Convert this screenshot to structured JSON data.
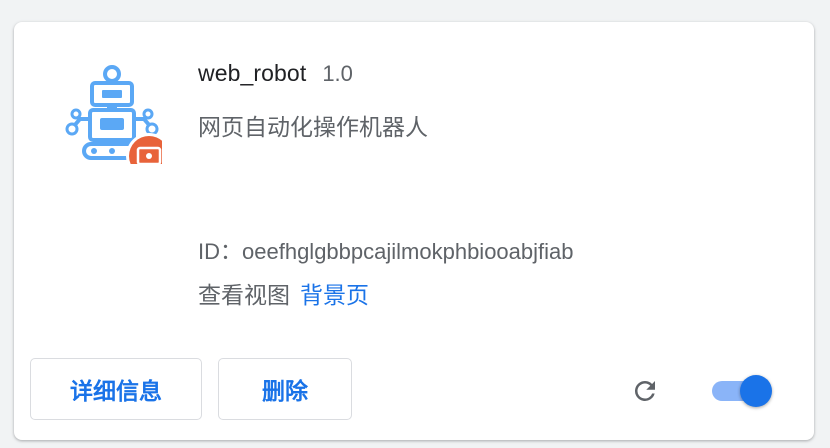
{
  "extension": {
    "name": "web_robot",
    "version": "1.0",
    "description": "网页自动化操作机器人",
    "id_label": "ID：",
    "id_value": "oeefhglgbbpcajilmokphbiooabjfiab",
    "views_label": "查看视图",
    "views_link": "背景页",
    "icon": "robot-icon",
    "badge_icon": "unpacked-badge-icon"
  },
  "footer": {
    "details_label": "详细信息",
    "remove_label": "删除",
    "reload_icon": "reload-icon",
    "enabled": true
  },
  "colors": {
    "accent": "#1a73e8",
    "robot_blue": "#5ba8f5",
    "badge_orange": "#e8633a",
    "toggle_track": "#8ab4f8",
    "toggle_knob": "#1a73e8"
  }
}
